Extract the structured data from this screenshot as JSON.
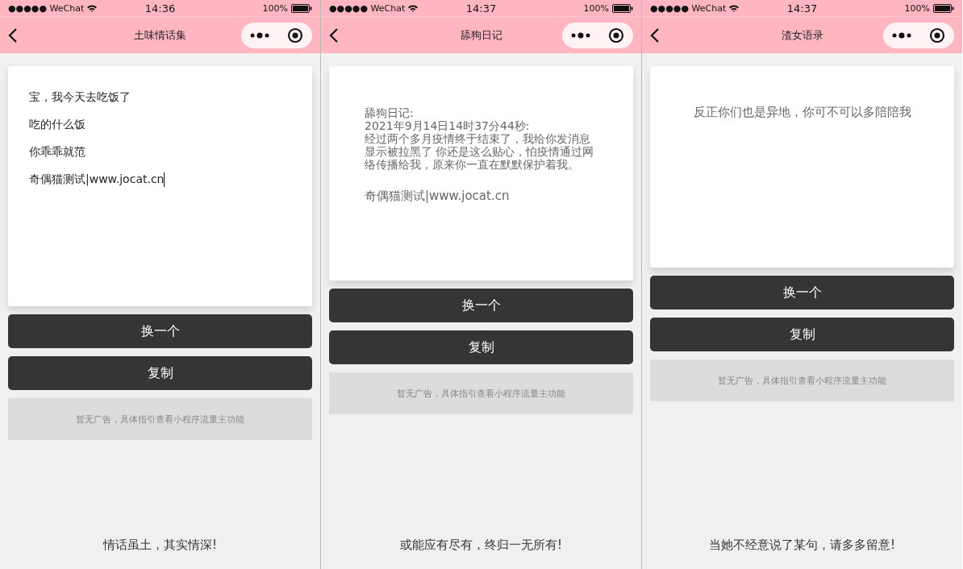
{
  "phones": [
    {
      "status_bar": {
        "carrier": "●●●●● WeChat",
        "time": "14:36",
        "battery": "100%"
      },
      "nav": {
        "title": "土味情话集"
      },
      "card": {
        "kind": "lines",
        "lines": [
          "宝，我今天去吃饭了",
          "吃的什么饭",
          "你乖乖就范",
          "奇偶猫测试|www.jocat.cn"
        ],
        "caret": true
      },
      "buttons": [
        "换一个",
        "复制"
      ],
      "ad": "暂无广告，具体指引查看小程序流量主功能",
      "footer": "情话虽土，其实情深!"
    },
    {
      "status_bar": {
        "carrier": "●●●●● WeChat",
        "time": "14:37",
        "battery": "100%"
      },
      "nav": {
        "title": "舔狗日记"
      },
      "card": {
        "kind": "block",
        "paragraphs": [
          "舔狗日记:",
          "2021年9月14日14时37分44秒:",
          "经过两个多月疫情终于结束了，我给你发消息显示被拉黑了 你还是这么贴心，怕疫情通过网络传播给我，原来你一直在默默保护着我。"
        ],
        "signature": "奇偶猫测试|www.jocat.cn"
      },
      "buttons": [
        "换一个",
        "复制"
      ],
      "ad": "暂无广告，具体指引查看小程序流量主功能",
      "footer": "或能应有尽有，终归一无所有!"
    },
    {
      "status_bar": {
        "carrier": "●●●●● WeChat",
        "time": "14:37",
        "battery": "100%"
      },
      "nav": {
        "title": "渣女语录"
      },
      "card": {
        "kind": "centered",
        "text": "反正你们也是异地，你可不可以多陪陪我"
      },
      "buttons": [
        "换一个",
        "复制"
      ],
      "ad": "暂无广告，具体指引查看小程序流量主功能",
      "footer": "当她不经意说了某句，请多多留意!"
    }
  ]
}
